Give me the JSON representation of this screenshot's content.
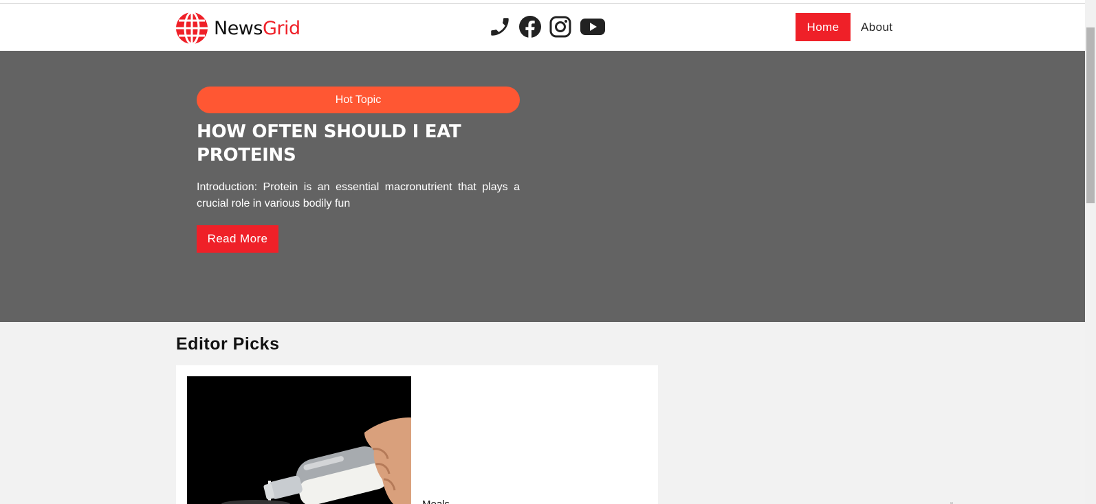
{
  "header": {
    "brand_part1": "News",
    "brand_part2": "Grid",
    "social_icons": [
      "phone-icon",
      "facebook-icon",
      "instagram-icon",
      "youtube-icon"
    ],
    "nav": {
      "home": "Home",
      "about": "About"
    }
  },
  "hero": {
    "badge": "Hot Topic",
    "title": "HOW OFTEN SHOULD I EAT PROTEINS",
    "excerpt": "Introduction: Protein is an essential macronutrient that plays a crucial role in various bodily fun",
    "cta": "Read More"
  },
  "editor_picks": {
    "heading": "Editor Picks",
    "cards": [
      {
        "category": "Meals"
      }
    ]
  },
  "colors": {
    "accent": "#ef2028",
    "badge": "#ff5733",
    "hero_bg": "#636363",
    "page_bg": "#f2f2f2"
  }
}
